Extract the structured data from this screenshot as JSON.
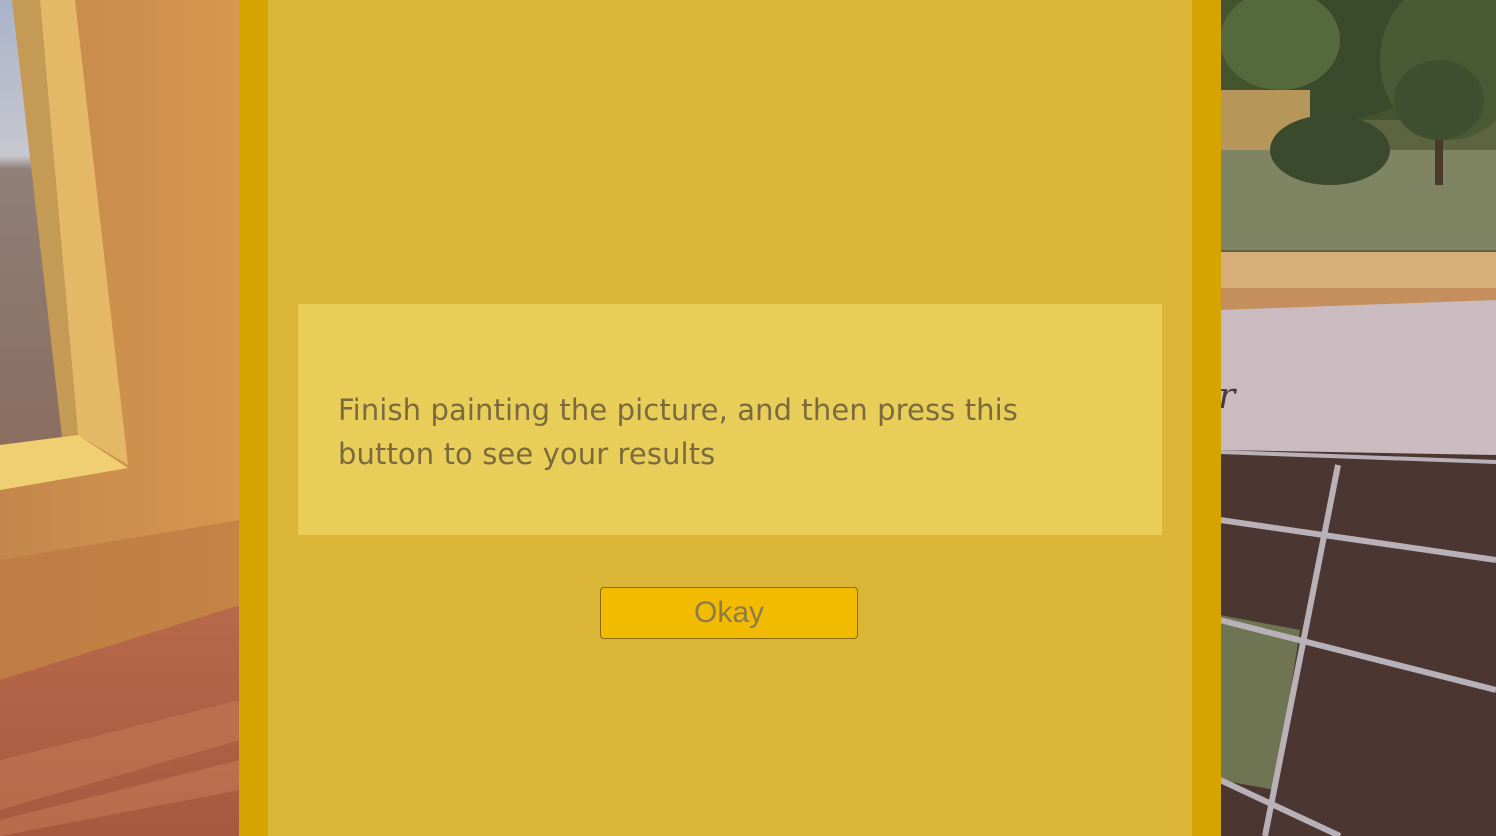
{
  "dialog": {
    "message": "Finish painting the picture, and then press this button to see your results",
    "okay_label": "Okay"
  },
  "colors": {
    "panel_frame": "#d6a401",
    "panel_inner": "#dbb535",
    "message_box": "#e8cd59",
    "button_fill": "#f2bb00",
    "text": "#7a6a3e"
  }
}
